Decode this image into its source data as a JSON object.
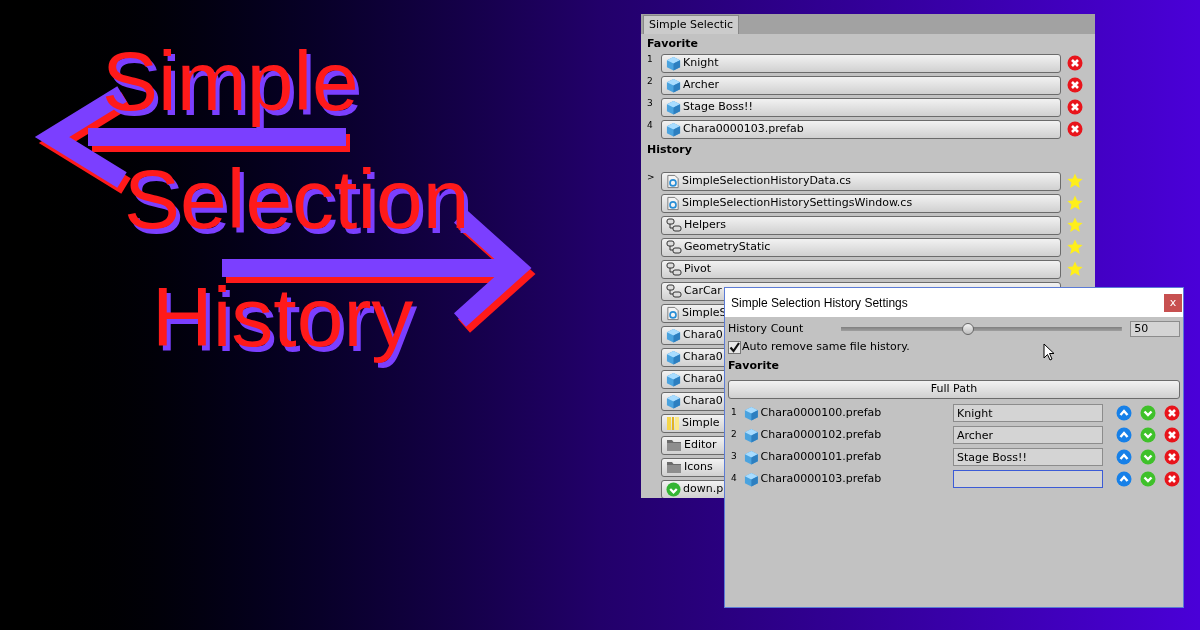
{
  "banner": {
    "title_lines": [
      "Simple",
      "Selection",
      "History"
    ]
  },
  "main_window": {
    "tab": "Simple Selectic",
    "favorite_header": "Favorite",
    "favorites": [
      {
        "index": "1",
        "name": "Knight"
      },
      {
        "index": "2",
        "name": "Archer"
      },
      {
        "index": "3",
        "name": "Stage Boss!!"
      },
      {
        "index": "4",
        "name": "Chara0000103.prefab"
      }
    ],
    "history_header": "History",
    "history": [
      {
        "marker": ">",
        "kind": "script",
        "name": "SimpleSelectionHistoryData.cs",
        "starred": true
      },
      {
        "kind": "script",
        "name": "SimpleSelectionHistorySettingsWindow.cs",
        "starred": true
      },
      {
        "kind": "gameobject",
        "name": "Helpers",
        "starred": true
      },
      {
        "kind": "gameobject",
        "name": "GeometryStatic",
        "starred": true
      },
      {
        "kind": "gameobject",
        "name": "Pivot",
        "starred": true
      },
      {
        "kind": "gameobject",
        "name": "CarCar"
      },
      {
        "kind": "script",
        "name": "SimpleS"
      },
      {
        "kind": "prefab",
        "name": "Chara0"
      },
      {
        "kind": "prefab",
        "name": "Chara0"
      },
      {
        "kind": "prefab",
        "name": "Chara0"
      },
      {
        "kind": "prefab",
        "name": "Chara0"
      },
      {
        "kind": "asset",
        "name": "Simple"
      },
      {
        "kind": "folder",
        "name": "Editor"
      },
      {
        "kind": "folder",
        "name": "Icons"
      },
      {
        "kind": "image",
        "name": "down.p"
      }
    ]
  },
  "settings_window": {
    "title": "Simple Selection History Settings",
    "close": "x",
    "history_count": {
      "label": "History Count",
      "level": 0.45,
      "value": "50"
    },
    "auto_remove": {
      "label": "Auto remove same file history.",
      "checked": true
    },
    "favorite_header": "Favorite",
    "full_path_button": "Full Path",
    "favorites": [
      {
        "index": "1",
        "name": "Chara0000100.prefab",
        "alias": "Knight",
        "focused": false
      },
      {
        "index": "2",
        "name": "Chara0000102.prefab",
        "alias": "Archer",
        "focused": false
      },
      {
        "index": "3",
        "name": "Chara0000101.prefab",
        "alias": "Stage Boss!!",
        "focused": false
      },
      {
        "index": "4",
        "name": "Chara0000103.prefab",
        "focused": true
      }
    ]
  }
}
